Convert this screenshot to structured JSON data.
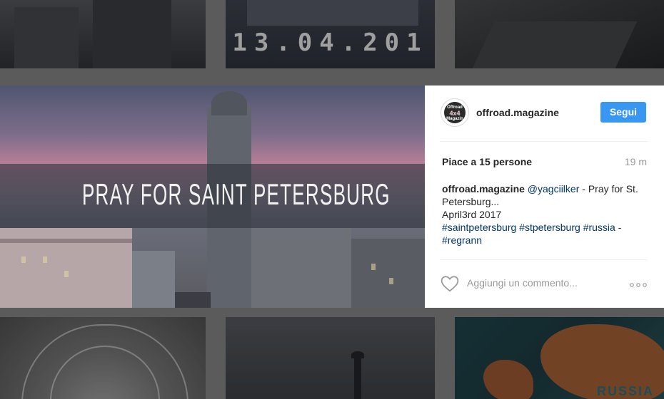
{
  "grid": {
    "top_middle_text": "13.04.201",
    "bottom_right_text": "RUSSIA"
  },
  "post": {
    "image_text": "PRAY FOR SAINT PETERSBURG",
    "username": "offroad.magazine",
    "follow_label": "Segui",
    "avatar_text": {
      "top": "Offroad",
      "middle": "4x4",
      "bottom": "Magazin"
    },
    "likes_text": "Piace a 15 persone",
    "timestamp": "19 m",
    "caption": {
      "username": "offroad.magazine",
      "mention": "@yagciilker",
      "text_line1": " - Pray for St. Petersburg...",
      "text_line2": "April3rd 2017",
      "hashtags": [
        "#saintpetersburg",
        "#stpetersburg",
        "#russia"
      ],
      "hashtag_separator": " ",
      "dash": " -",
      "last_hashtag": "#regrann"
    },
    "comment_placeholder": "Aggiungi un commento..."
  },
  "icons": {
    "like": "heart-icon",
    "more": "more-options-icon"
  }
}
